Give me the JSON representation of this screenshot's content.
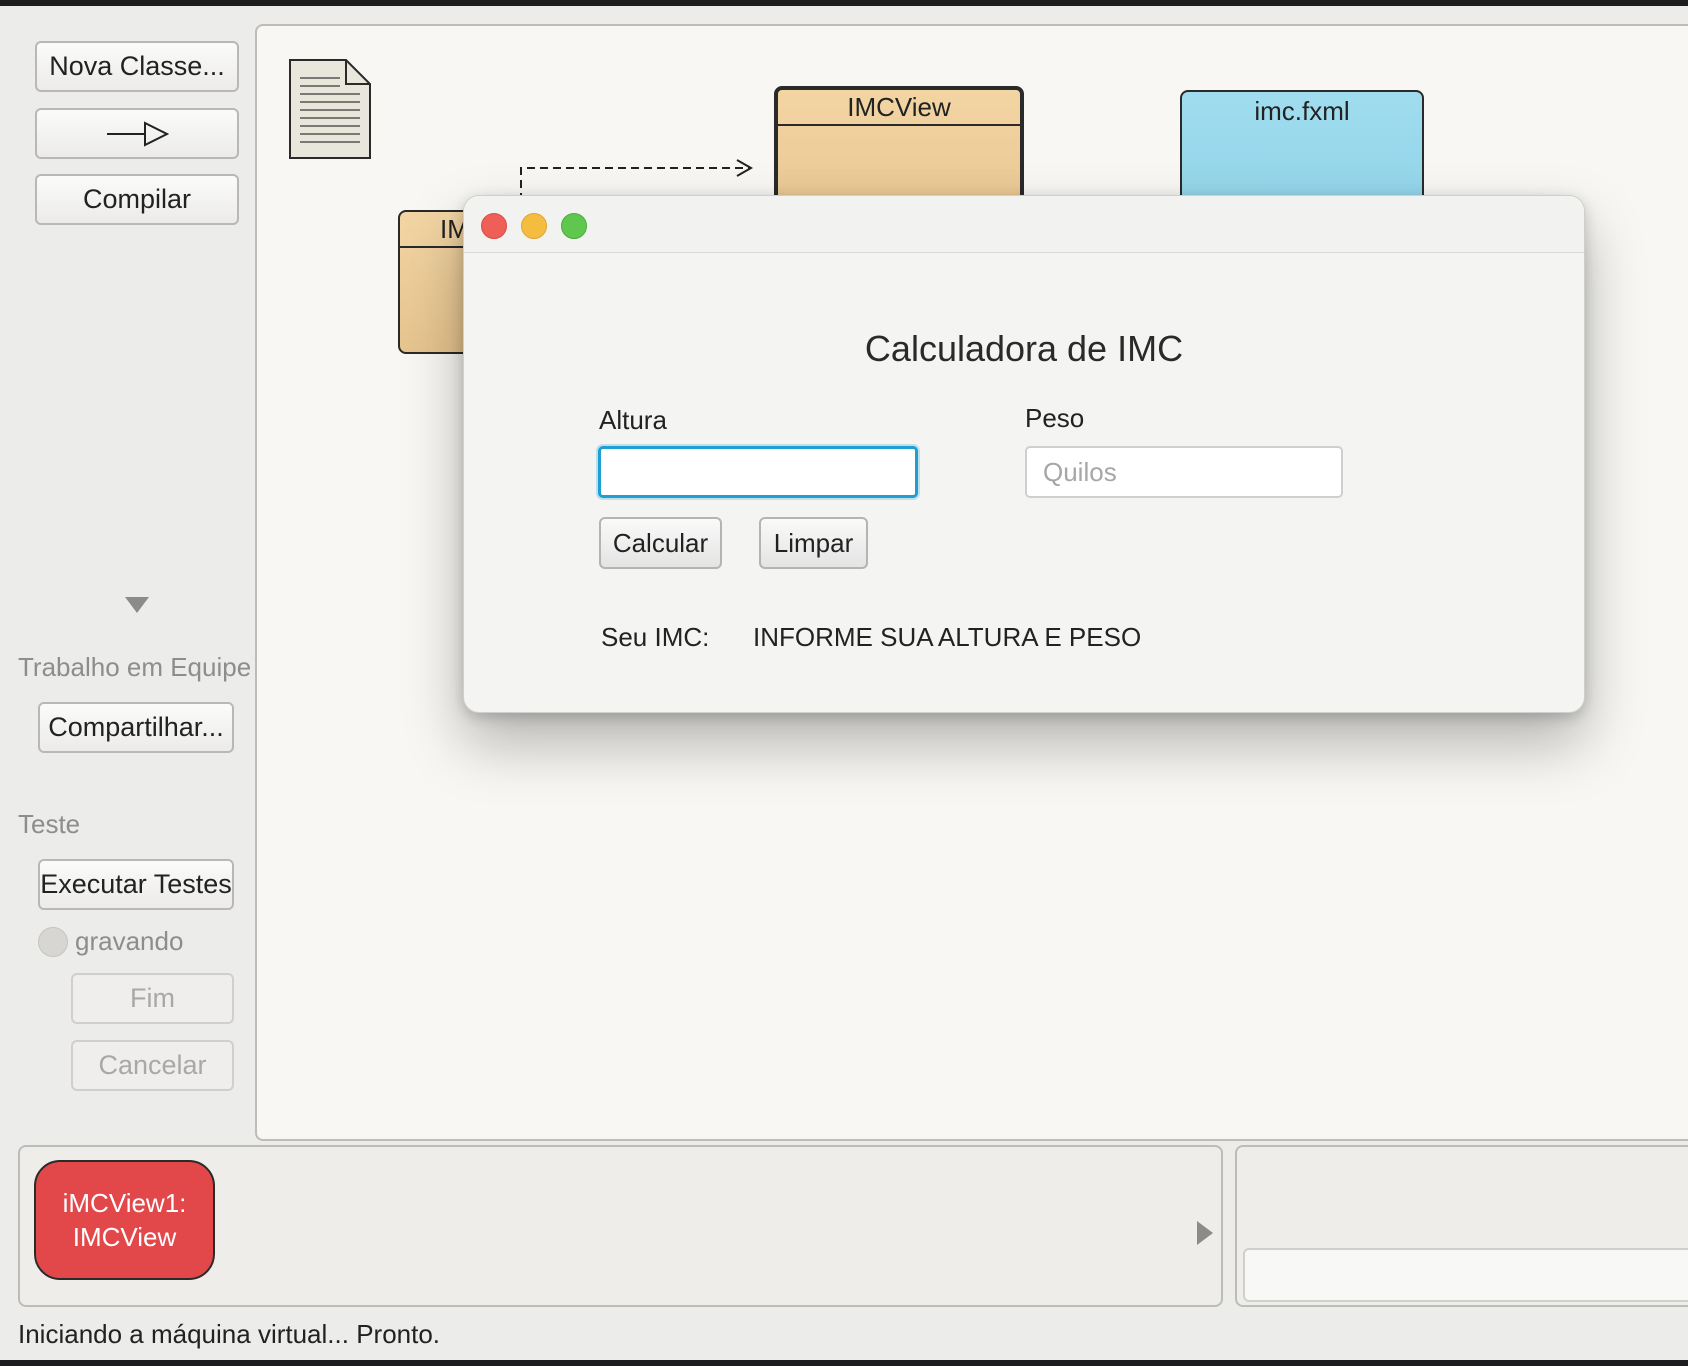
{
  "sidebar": {
    "new_class_label": "Nova Classe...",
    "compile_label": "Compilar",
    "team_heading": "Trabalho em Equipe",
    "share_label": "Compartilhar...",
    "test_heading": "Teste",
    "run_tests_label": "Executar Testes",
    "recording_label": "gravando",
    "end_label": "Fim",
    "cancel_label": "Cancelar"
  },
  "diagram": {
    "classes": [
      {
        "name": "IMCView",
        "color": "#eccb97"
      },
      {
        "name": "IM",
        "color": "#eccb97"
      }
    ],
    "fxml_file": {
      "name": "imc.fxml",
      "color": "#93d5ea"
    }
  },
  "dialog": {
    "title": "Calculadora de IMC",
    "height_label": "Altura",
    "height_value": "",
    "weight_label": "Peso",
    "weight_placeholder": "Quilos",
    "calculate_label": "Calcular",
    "clear_label": "Limpar",
    "result_label": "Seu IMC:",
    "result_value": "INFORME SUA ALTURA E PESO",
    "traffic_colors": {
      "close": "#ed5f57",
      "minimize": "#f5bd40",
      "zoom": "#5fc74e"
    }
  },
  "object_bench": {
    "objects": [
      {
        "line1": "iMCView1:",
        "line2": "IMCView",
        "color": "#e2474a"
      }
    ]
  },
  "status_bar": {
    "text": "Iniciando a máquina virtual... Pronto."
  }
}
